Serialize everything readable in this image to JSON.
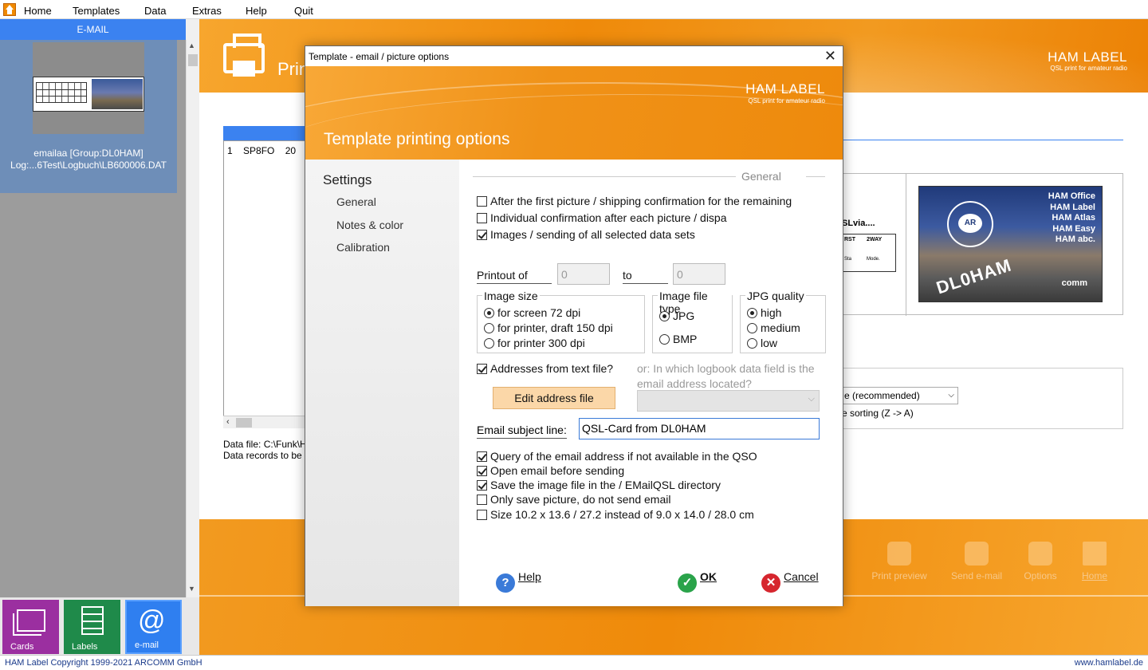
{
  "menu": {
    "items": [
      "Home",
      "Templates",
      "Data",
      "Extras",
      "Help",
      "Quit"
    ]
  },
  "left_panel": {
    "header": "E-MAIL",
    "selected_line1": "emailaa [Group:DL0HAM]",
    "selected_line2": "Log:...6Test\\Logbuch\\LB600006.DAT"
  },
  "tiles": {
    "cards": "Cards",
    "labels": "Labels",
    "email": "e-mail"
  },
  "status": {
    "copyright": "HAM Label Copyright 1999-2021 ARCOMM GmbH",
    "website": "www.hamlabel.de"
  },
  "main": {
    "title": "Print",
    "brand_name": "HAM LABEL",
    "brand_sub": "QSL print for amateur radio",
    "list_row": {
      "nr": "1",
      "call": "SP8FO",
      "date": "20"
    },
    "datafile_line1": "Data file: C:\\Funk\\H",
    "datafile_line2": "Data records to be",
    "preview": {
      "qsl_via": "SLvia....",
      "col_rst": "RST",
      "col_2way": "2WAY",
      "cell_mode": "Mode.",
      "cell_1": "Sta",
      "pic_lines": [
        "HAM Office",
        "HAM Label",
        "HAM Atlas",
        "HAM Easy",
        "HAM abc."
      ],
      "pic_call": "DL0HAM",
      "pic_comm": "comm",
      "pic_logo": "AR"
    },
    "sort_value": "e (recommended)",
    "sort_desc": "e sorting (Z -> A)",
    "actions": [
      "Print preview",
      "Send e-mail",
      "Options",
      "Home"
    ]
  },
  "dialog": {
    "title": "Template - email / picture options",
    "close": "✕",
    "brand_name": "HAM LABEL",
    "brand_sub": "QSL print for amateur radio",
    "heading": "Template printing options",
    "nav": {
      "title": "Settings",
      "items": [
        "General",
        "Notes & color",
        "Calibration"
      ]
    },
    "section": "General",
    "checks_top": [
      {
        "label": "After the first picture / shipping confirmation for the remaining",
        "checked": false
      },
      {
        "label": "Individual confirmation after each picture / dispa",
        "checked": false
      },
      {
        "label": "Images / sending of all selected data sets",
        "checked": true
      }
    ],
    "printout_label": "Printout of",
    "printout_from": "0",
    "to_label": "to",
    "printout_to": "0",
    "image_size": {
      "title": "Image size",
      "options": [
        "for screen 72 dpi",
        "for printer, draft 150 dpi",
        "for printer 300 dpi"
      ],
      "selected": 0
    },
    "image_type": {
      "title": "Image file type",
      "options": [
        "JPG",
        "BMP"
      ],
      "selected": 0
    },
    "jpg_quality": {
      "title": "JPG quality",
      "options": [
        "high",
        "medium",
        "low"
      ],
      "selected": 0
    },
    "addresses_check": {
      "label": "Addresses from text file?",
      "checked": true
    },
    "hint": "or: In which logbook data field is the email address located?",
    "edit_address_button": "Edit address file",
    "subject_label": "Email subject line:",
    "subject_value": "QSL-Card from DL0HAM",
    "checks_bottom": [
      {
        "label": "Query of the email address if not available in the QSO",
        "checked": true
      },
      {
        "label": "Open email before sending",
        "checked": true
      },
      {
        "label": "Save the image file in the / EMailQSL directory",
        "checked": true
      },
      {
        "label": "Only save picture, do not send email",
        "checked": false
      },
      {
        "label": "Size 10.2 x 13.6 / 27.2 instead of 9.0 x 14.0 / 28.0 cm",
        "checked": false
      }
    ],
    "buttons": {
      "help": "Help",
      "ok": "OK",
      "cancel": "Cancel"
    }
  },
  "colors": {
    "accent_orange": "#ef8a0a",
    "selection_blue": "#3b82f0",
    "button_highlight": "#fbd7a8"
  }
}
